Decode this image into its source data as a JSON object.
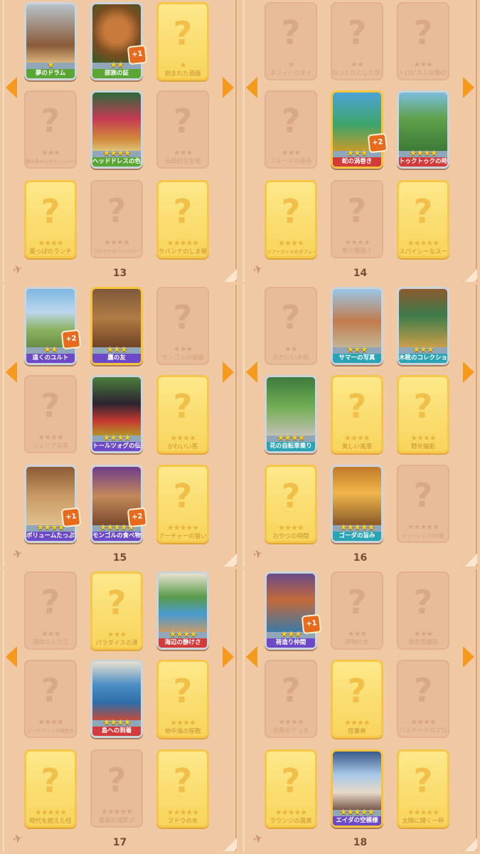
{
  "pages": [
    {
      "number": "13",
      "cards": [
        {
          "state": "collected",
          "label": "夢のドラム",
          "stars": 1,
          "band": "green",
          "art": "drum"
        },
        {
          "state": "collected",
          "label": "部族の証",
          "stars": 2,
          "band": "green",
          "art": "mask",
          "badge": "+1"
        },
        {
          "state": "gold",
          "label": "刻まれた酒器",
          "stars": 1
        },
        {
          "state": "empty",
          "label": "積み重ねられたシンボル",
          "stars": 3,
          "small": true
        },
        {
          "state": "collected",
          "label": "ヘッドドレスの色合い",
          "stars": 4,
          "band": "green",
          "art": "headdress",
          "small": true
        },
        {
          "state": "empty",
          "label": "伝統的な生地",
          "stars": 3
        },
        {
          "state": "gold",
          "label": "葉っぱのランチ",
          "stars": 4
        },
        {
          "state": "empty",
          "label": "さわやかなバンガロー",
          "stars": 4,
          "small": true
        },
        {
          "state": "gold",
          "label": "サバンナのしま模様",
          "stars": 5
        }
      ]
    },
    {
      "number": "14",
      "cards": [
        {
          "state": "empty",
          "label": "タフィーのタイ",
          "stars": 1
        },
        {
          "state": "empty",
          "label": "ねっとりとした甘さ",
          "stars": 2
        },
        {
          "state": "empty",
          "label": "トロピカルな静けさ",
          "stars": 3
        },
        {
          "state": "empty",
          "label": "フルーツの恵み",
          "stars": 3
        },
        {
          "state": "collected",
          "label": "蛇の渦巻き",
          "stars": 3,
          "band": "red",
          "art": "serpent",
          "badge": "+2",
          "frame": "gold"
        },
        {
          "state": "collected",
          "label": "トゥクトゥクの時間",
          "stars": 4,
          "band": "red",
          "art": "tuktuk",
          "small": true
        },
        {
          "state": "gold",
          "label": "ツアーガイドのタフィー",
          "stars": 4,
          "small": true
        },
        {
          "state": "empty",
          "label": "象の優雅さ",
          "stars": 4
        },
        {
          "state": "gold",
          "label": "スパイシーなスープ",
          "stars": 5
        }
      ]
    },
    {
      "number": "15",
      "cards": [
        {
          "state": "collected",
          "label": "遠くのユルト",
          "stars": 2,
          "band": "purple",
          "art": "yurt",
          "badge": "+2"
        },
        {
          "state": "collected",
          "label": "鷹の友",
          "stars": 3,
          "band": "purple",
          "art": "falcon",
          "frame": "gold"
        },
        {
          "state": "empty",
          "label": "モンゴルの威厳",
          "stars": 3
        },
        {
          "state": "empty",
          "label": "ジュリアの羊",
          "stars": 4
        },
        {
          "state": "collected",
          "label": "トールツォグの伝統",
          "stars": 4,
          "band": "purple",
          "art": "hat",
          "small": true
        },
        {
          "state": "gold",
          "label": "かわいい馬",
          "stars": 4
        },
        {
          "state": "collected",
          "label": "ボリュームたっぷりの鍋",
          "stars": 4,
          "band": "purple",
          "art": "pot",
          "badge": "+1",
          "small": true
        },
        {
          "state": "collected",
          "label": "モンゴルの食べ物",
          "stars": 5,
          "band": "purple",
          "art": "food",
          "badge": "+2"
        },
        {
          "state": "gold",
          "label": "アーチャーの狙い",
          "stars": 5
        }
      ]
    },
    {
      "number": "16",
      "cards": [
        {
          "state": "empty",
          "label": "かわいい木靴",
          "stars": 2
        },
        {
          "state": "collected",
          "label": "サマーの写真",
          "stars": 3,
          "band": "teal",
          "art": "photo"
        },
        {
          "state": "collected",
          "label": "木靴のコレクション",
          "stars": 3,
          "band": "teal",
          "art": "clogs",
          "small": true
        },
        {
          "state": "collected",
          "label": "花の自転車乗り",
          "stars": 4,
          "band": "teal",
          "art": "bike"
        },
        {
          "state": "gold",
          "label": "美しい風車",
          "stars": 4
        },
        {
          "state": "gold",
          "label": "野外撮影",
          "stars": 4
        },
        {
          "state": "gold",
          "label": "おやつの時間",
          "stars": 4
        },
        {
          "state": "collected",
          "label": "ゴーダの旨み",
          "stars": 5,
          "band": "teal",
          "art": "cheese"
        },
        {
          "state": "empty",
          "label": "チューリップの収穫",
          "stars": 5,
          "small": true
        }
      ]
    },
    {
      "number": "17",
      "cards": [
        {
          "state": "empty",
          "label": "海岸の入り江",
          "stars": 3
        },
        {
          "state": "gold",
          "label": "パラダイスの港",
          "stars": 3
        },
        {
          "state": "collected",
          "label": "海辺の静けさ",
          "stars": 4,
          "band": "red",
          "art": "seaside"
        },
        {
          "state": "empty",
          "label": "ビーチサイドの朝散歩",
          "stars": 4,
          "small": true
        },
        {
          "state": "collected",
          "label": "島への到着",
          "stars": 4,
          "band": "red",
          "art": "boat"
        },
        {
          "state": "gold",
          "label": "地中海の屋敷",
          "stars": 4
        },
        {
          "state": "gold",
          "label": "時代を超えた柱",
          "stars": 5
        },
        {
          "state": "empty",
          "label": "農家の誠実さ",
          "stars": 5
        },
        {
          "state": "gold",
          "label": "ブドウの木",
          "stars": 5
        }
      ]
    },
    {
      "number": "18",
      "cards": [
        {
          "state": "collected",
          "label": "荷造り仲間",
          "stars": 3,
          "band": "purple",
          "art": "packing",
          "badge": "+1"
        },
        {
          "state": "empty",
          "label": "荷物の友",
          "stars": 3
        },
        {
          "state": "empty",
          "label": "滑走路離陸",
          "stars": 3
        },
        {
          "state": "empty",
          "label": "出発のデュオ",
          "stars": 4
        },
        {
          "state": "gold",
          "label": "搭乗券",
          "stars": 4
        },
        {
          "state": "empty",
          "label": "パスポートのプロ",
          "stars": 4
        },
        {
          "state": "gold",
          "label": "ラウンジの風景",
          "stars": 5
        },
        {
          "state": "collected",
          "label": "エイダの空模様",
          "stars": 5,
          "band": "purple",
          "art": "window",
          "frame": "gold"
        },
        {
          "state": "gold",
          "label": "太陽に輝く一杯",
          "stars": 5
        }
      ]
    }
  ],
  "icons": {
    "question": "?",
    "plane": "✈",
    "star": "★"
  },
  "colors": {
    "arrow": "#f59a1c",
    "band_green": "#5aa634",
    "band_red": "#d33a3a",
    "band_purple": "#6c49c6",
    "band_teal": "#2aa3b4",
    "badge": "#e86a1c"
  }
}
